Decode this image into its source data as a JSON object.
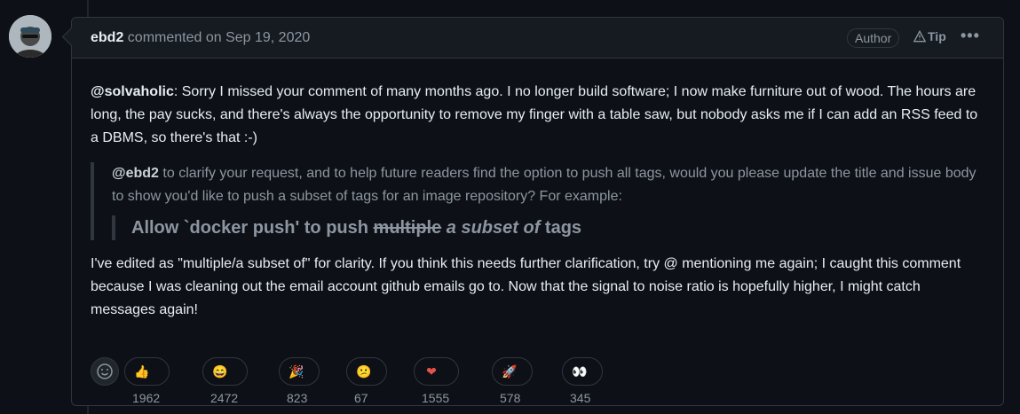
{
  "header": {
    "author": "ebd2",
    "action": "commented on Sep 19, 2020",
    "badge": "Author",
    "tip": "Tip",
    "more": "•••"
  },
  "body": {
    "p1_mention": "@solvaholic",
    "p1_text": ": Sorry I missed your comment of many months ago. I no longer build software; I now make furniture out of wood. The hours are long, the pay sucks, and there's always the opportunity to remove my finger with a table saw, but nobody asks me if I can add an RSS feed to a DBMS, so there's that :-)",
    "quote_mention": "@ebd2",
    "quote_text": " to clarify your request, and to help future readers find the option to push all tags, would you please update the title and issue body to show you'd like to push a subset of tags for an image repository? For example:",
    "quote_title_a": "Allow `docker push' to push ",
    "quote_title_strike": "multiple",
    "quote_title_em": " a subset of",
    "quote_title_b": " tags",
    "p2_text": "I've edited as \"multiple/a subset of\" for clarity. If you think this needs further clarification, try @ mentioning me again; I caught this comment because I was cleaning out the email account github emails go to. Now that the signal to noise ratio is hopefully higher, I might catch messages again!"
  },
  "reactions": [
    {
      "emoji": "👍",
      "icon": "thumbs-up",
      "count": "1962"
    },
    {
      "emoji": "😄",
      "icon": "laugh",
      "count": "2472"
    },
    {
      "emoji": "🎉",
      "icon": "hooray",
      "count": "823"
    },
    {
      "emoji": "😕",
      "icon": "confused",
      "count": "67"
    },
    {
      "emoji": "❤",
      "icon": "heart",
      "count": "1555"
    },
    {
      "emoji": "🚀",
      "icon": "rocket",
      "count": "578"
    },
    {
      "emoji": "👀",
      "icon": "eyes",
      "count": "345"
    }
  ]
}
